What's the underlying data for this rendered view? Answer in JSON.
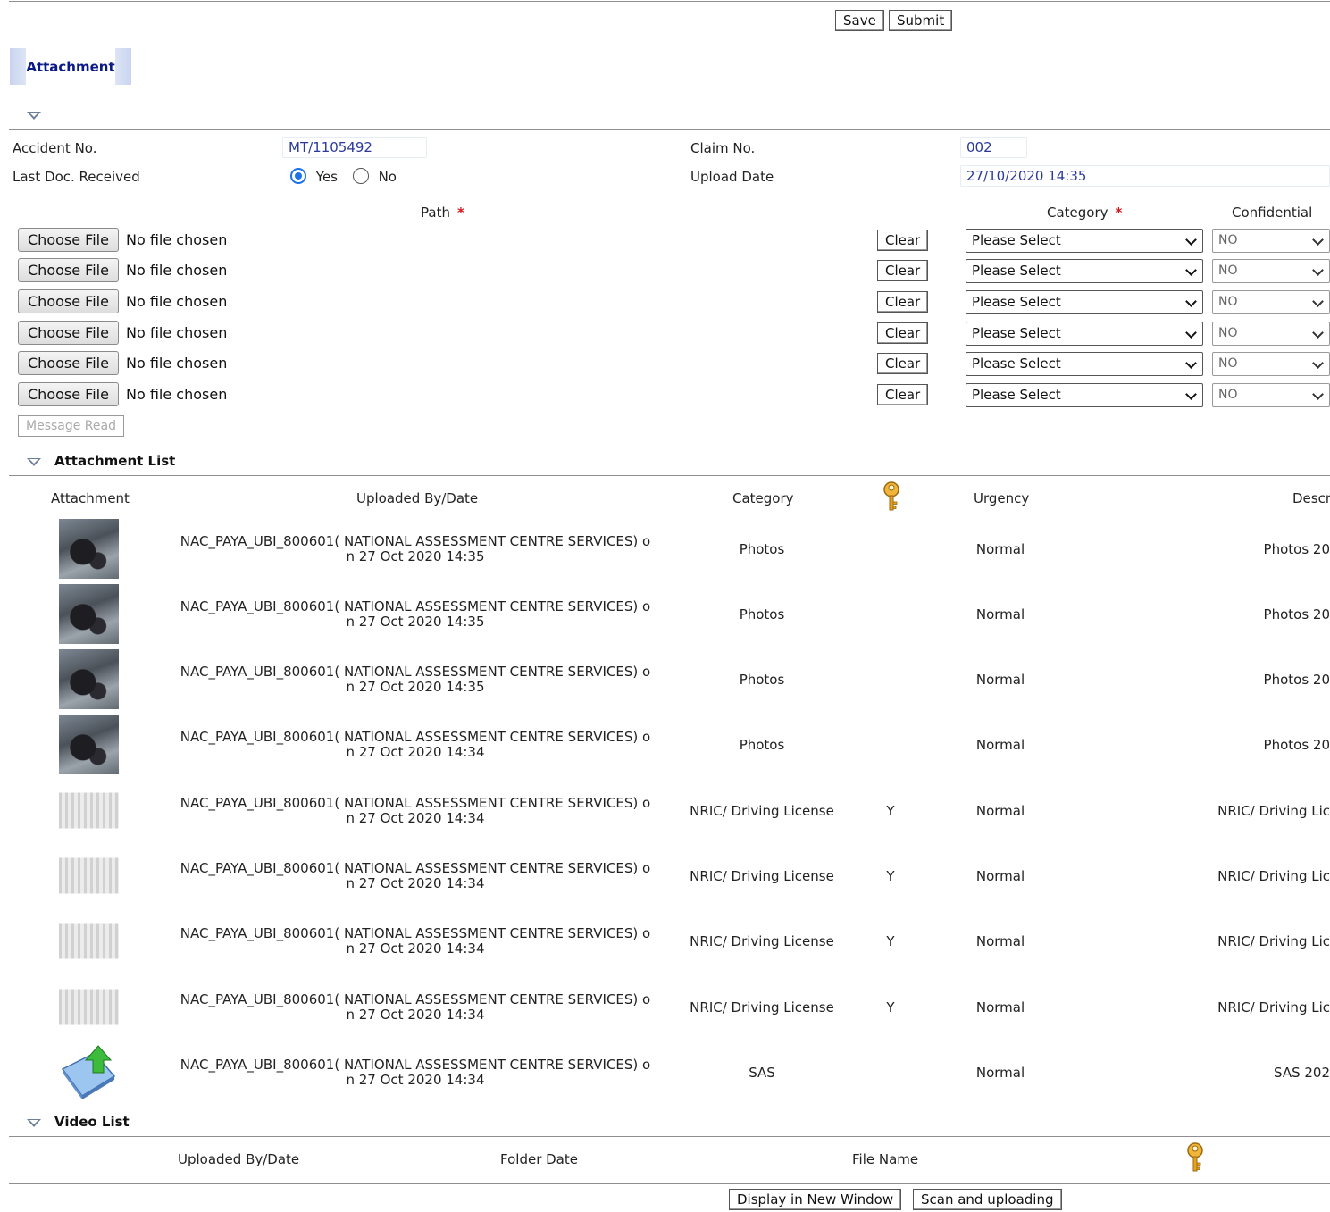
{
  "toolbar": {
    "save": "Save",
    "submit": "Submit"
  },
  "tab": {
    "label": "Attachment"
  },
  "form": {
    "accident_no_label": "Accident No.",
    "accident_no": "MT/1105492",
    "claim_no_label": "Claim No.",
    "claim_no": "002",
    "last_doc_label": "Last Doc. Received",
    "yes": "Yes",
    "no": "No",
    "last_doc_selected": "Yes",
    "upload_date_label": "Upload Date",
    "upload_date": "27/10/2020 14:35"
  },
  "upload": {
    "path_label": "Path",
    "category_label": "Category",
    "confidential_label": "Confidential",
    "choose_file": "Choose File",
    "no_file": "No file chosen",
    "clear": "Clear",
    "category_default": "Please Select",
    "confidential_default": "NO",
    "message_read": "Message Read"
  },
  "attachment_list": {
    "title": "Attachment List",
    "headers": {
      "attachment": "Attachment",
      "uploaded_by": "Uploaded By/Date",
      "category": "Category",
      "urgency": "Urgency",
      "description": "Descr"
    },
    "rows": [
      {
        "thumb": "photo",
        "uploaded_line1": "NAC_PAYA_UBI_800601( NATIONAL ASSESSMENT CENTRE SERVICES) o",
        "uploaded_line2": "n 27 Oct 2020 14:35",
        "category": "Photos",
        "confidential": "",
        "urgency": "Normal",
        "description": "Photos 20"
      },
      {
        "thumb": "photo",
        "uploaded_line1": "NAC_PAYA_UBI_800601( NATIONAL ASSESSMENT CENTRE SERVICES) o",
        "uploaded_line2": "n 27 Oct 2020 14:35",
        "category": "Photos",
        "confidential": "",
        "urgency": "Normal",
        "description": "Photos 20"
      },
      {
        "thumb": "photo",
        "uploaded_line1": "NAC_PAYA_UBI_800601( NATIONAL ASSESSMENT CENTRE SERVICES) o",
        "uploaded_line2": "n 27 Oct 2020 14:35",
        "category": "Photos",
        "confidential": "",
        "urgency": "Normal",
        "description": "Photos 20"
      },
      {
        "thumb": "photo",
        "uploaded_line1": "NAC_PAYA_UBI_800601( NATIONAL ASSESSMENT CENTRE SERVICES) o",
        "uploaded_line2": "n 27 Oct 2020 14:34",
        "category": "Photos",
        "confidential": "",
        "urgency": "Normal",
        "description": "Photos 20"
      },
      {
        "thumb": "doc",
        "uploaded_line1": "NAC_PAYA_UBI_800601( NATIONAL ASSESSMENT CENTRE SERVICES) o",
        "uploaded_line2": "n 27 Oct 2020 14:34",
        "category": "NRIC/ Driving License",
        "confidential": "Y",
        "urgency": "Normal",
        "description": "NRIC/ Driving Lic"
      },
      {
        "thumb": "doc",
        "uploaded_line1": "NAC_PAYA_UBI_800601( NATIONAL ASSESSMENT CENTRE SERVICES) o",
        "uploaded_line2": "n 27 Oct 2020 14:34",
        "category": "NRIC/ Driving License",
        "confidential": "Y",
        "urgency": "Normal",
        "description": "NRIC/ Driving Lic"
      },
      {
        "thumb": "doc",
        "uploaded_line1": "NAC_PAYA_UBI_800601( NATIONAL ASSESSMENT CENTRE SERVICES) o",
        "uploaded_line2": "n 27 Oct 2020 14:34",
        "category": "NRIC/ Driving License",
        "confidential": "Y",
        "urgency": "Normal",
        "description": "NRIC/ Driving Lic"
      },
      {
        "thumb": "doc",
        "uploaded_line1": "NAC_PAYA_UBI_800601( NATIONAL ASSESSMENT CENTRE SERVICES) o",
        "uploaded_line2": "n 27 Oct 2020 14:34",
        "category": "NRIC/ Driving License",
        "confidential": "Y",
        "urgency": "Normal",
        "description": "NRIC/ Driving Lic"
      },
      {
        "thumb": "file",
        "uploaded_line1": "NAC_PAYA_UBI_800601( NATIONAL ASSESSMENT CENTRE SERVICES) o",
        "uploaded_line2": "n 27 Oct 2020 14:34",
        "category": "SAS",
        "confidential": "",
        "urgency": "Normal",
        "description": "SAS 202"
      }
    ]
  },
  "video_list": {
    "title": "Video List",
    "headers": {
      "uploaded_by": "Uploaded By/Date",
      "folder_date": "Folder Date",
      "file_name": "File Name"
    }
  },
  "footer": {
    "display_new_window": "Display in New Window",
    "scan_upload": "Scan and uploading"
  },
  "icons": {
    "collapse": "collapse-triangle-icon",
    "key": "key-icon",
    "upload_file": "upload-file-icon"
  },
  "colors": {
    "tab_text": "#0a1a86",
    "value_text": "#2b3a9a",
    "required": "#d4161b",
    "key": "#e8a21c"
  }
}
